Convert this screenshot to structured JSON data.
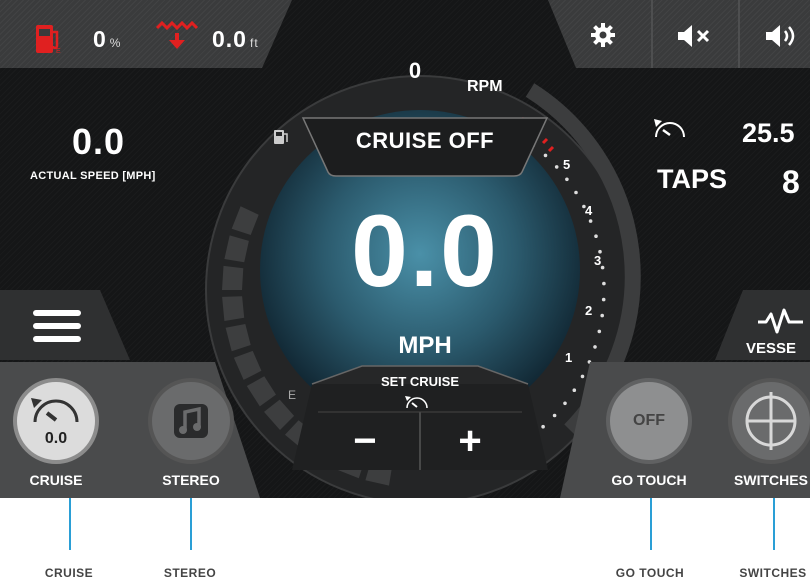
{
  "top_left": {
    "fuel_level": "0",
    "fuel_unit": "%",
    "depth_value": "0.0",
    "depth_unit": "ft"
  },
  "rpm": {
    "value": "0",
    "label": "RPM"
  },
  "cruise_status": "CRUISE OFF",
  "speed": {
    "value": "0.0",
    "unit": "MPH"
  },
  "actual_speed": {
    "value": "0.0",
    "label": "ACTUAL SPEED [MPH]"
  },
  "set_cruise": {
    "label": "SET CRUISE",
    "minus": "−",
    "plus": "+"
  },
  "cruise_set_value": "25.5",
  "taps": {
    "label": "TAPS",
    "value": "8"
  },
  "fuel_gauge": {
    "empty_label": "E",
    "level": 0
  },
  "rpm_ticks": [
    "1",
    "2",
    "3",
    "4",
    "5"
  ],
  "vessel_label": "VESSE",
  "bottom_buttons": {
    "cruise": {
      "label": "CRUISE",
      "value": "0.0"
    },
    "stereo": {
      "label": "STEREO"
    },
    "go_touch": {
      "label": "GO TOUCH",
      "state": "OFF"
    },
    "switches": {
      "label": "SWITCHES"
    }
  },
  "callouts": [
    "CRUISE",
    "STEREO",
    "GO TOUCH",
    "SWITCHES"
  ],
  "colors": {
    "accent_blue": "#2a9fd6",
    "warning_red": "#e02020"
  }
}
